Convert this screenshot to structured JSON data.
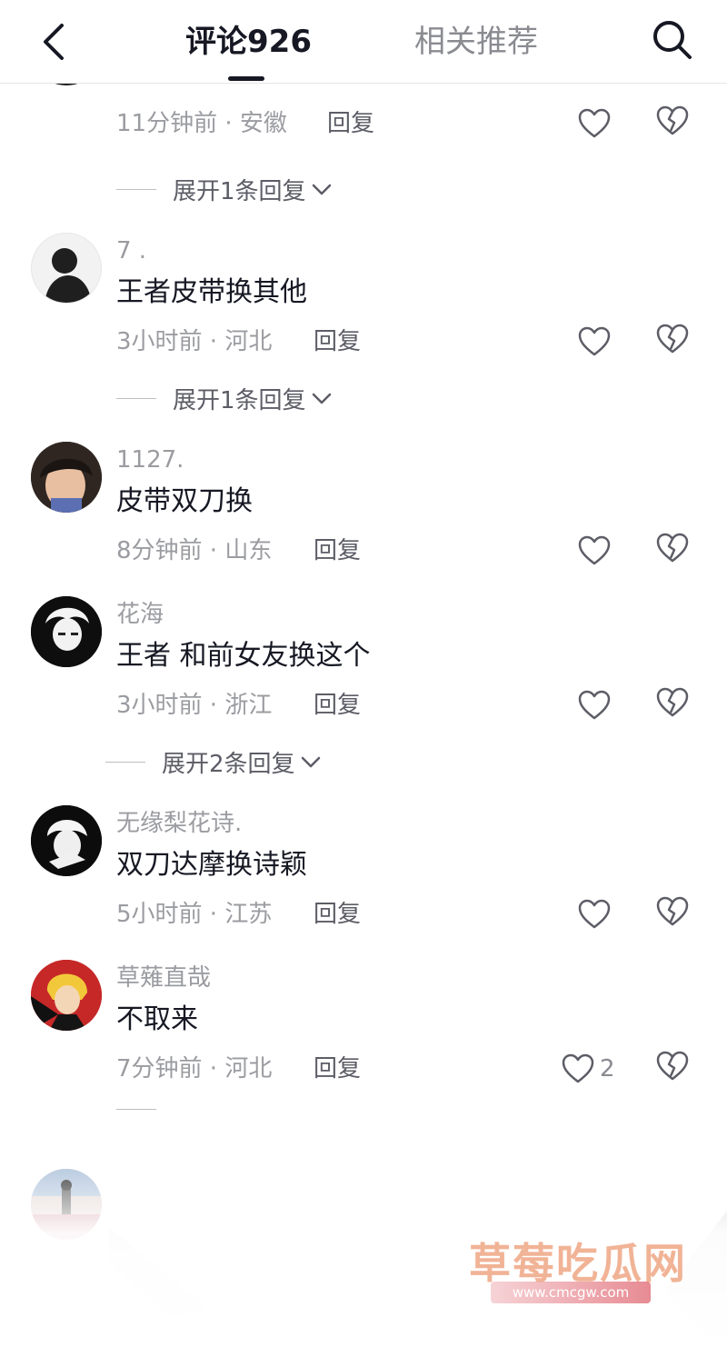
{
  "header": {
    "back_icon": "chevron-left-icon",
    "tab_comments": "评论926",
    "tab_related": "相关推荐",
    "search_icon": "search-icon"
  },
  "comments": [
    {
      "username": "",
      "text": "",
      "time": "11分钟前",
      "location": "安徽",
      "reply": "回复",
      "expand": "展开1条回复"
    },
    {
      "username": "7 .",
      "text": "王者皮带换其他",
      "time": "3小时前",
      "location": "河北",
      "reply": "回复",
      "expand": "展开1条回复"
    },
    {
      "username": "1127.",
      "text": "皮带双刀换",
      "time": "8分钟前",
      "location": "山东",
      "reply": "回复"
    },
    {
      "username": "花海",
      "text": "王者 和前女友换这个",
      "time": "3小时前",
      "location": "浙江",
      "reply": "回复",
      "expand": "展开2条回复"
    },
    {
      "username": "无缘梨花诗.",
      "text": "双刀达摩换诗颖",
      "time": "5小时前",
      "location": "江苏",
      "reply": "回复"
    },
    {
      "username": "草薙直哉",
      "text": "不取来",
      "time": "7分钟前",
      "location": "河北",
      "reply": "回复",
      "likes": "2"
    }
  ],
  "watermark": {
    "title": "草莓吃瓜网",
    "url": "www.cmcgw.com"
  },
  "colors": {
    "primary_text": "#161823",
    "secondary_text": "#9b9ca1",
    "tab_inactive": "#8a8b91"
  }
}
